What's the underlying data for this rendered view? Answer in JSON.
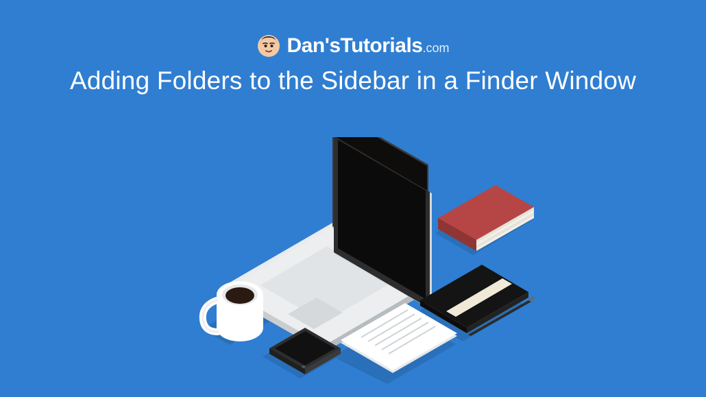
{
  "brand": {
    "name_main": "Dan'sTutorials",
    "name_suffix": ".com"
  },
  "headline": "Adding Folders to the Sidebar in a Finder Window",
  "illustration": {
    "items": [
      "laptop",
      "coffee-mug",
      "smartphone",
      "paper-sheet",
      "notebook",
      "pen",
      "book"
    ]
  },
  "colors": {
    "background": "#2f7ed1",
    "text": "#ffffff",
    "laptop_body": "#e9ebec",
    "laptop_body_shade": "#c7cbce",
    "laptop_screen": "#0e0d0c",
    "mug": "#ffffff",
    "mug_shade": "#d9dde0",
    "coffee": "#2a1a12",
    "phone_body": "#2e2e2e",
    "phone_body_light": "#4a4a4a",
    "phone_screen": "#111111",
    "paper": "#ffffff",
    "paper_shade": "#e7e9eb",
    "paper_line": "#cfd3d6",
    "notebook_cover": "#141414",
    "notebook_band": "#f0e9d8",
    "notebook_side": "#c9cbcc",
    "book_cover": "#b64645",
    "book_cover_dark": "#8f3535",
    "book_pages": "#f2efe8",
    "pen": "#2b2b2b",
    "shadow": "#2a6fb9"
  }
}
